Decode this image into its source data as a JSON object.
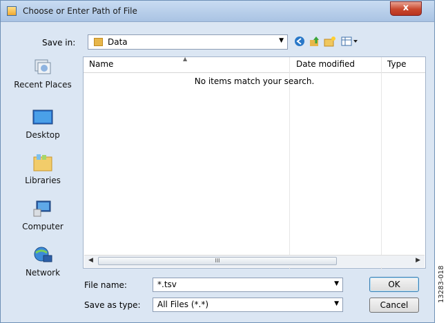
{
  "window": {
    "title": "Choose or Enter Path of File",
    "close_glyph": "x"
  },
  "toolbar": {
    "save_in_label": "Save in:",
    "current_folder": "Data",
    "icons": [
      "back-icon",
      "up-folder-icon",
      "new-folder-icon",
      "view-menu-icon"
    ]
  },
  "places": [
    {
      "label": "Recent Places",
      "icon": "recent-places-icon"
    },
    {
      "label": "Desktop",
      "icon": "desktop-icon"
    },
    {
      "label": "Libraries",
      "icon": "libraries-icon"
    },
    {
      "label": "Computer",
      "icon": "computer-icon"
    },
    {
      "label": "Network",
      "icon": "network-icon"
    }
  ],
  "filelist": {
    "columns": [
      "Name",
      "Date modified",
      "Type"
    ],
    "empty_message": "No items match your search.",
    "scroll_grip": "III"
  },
  "form": {
    "file_name_label": "File name:",
    "file_name_value": "*.tsv",
    "save_as_type_label": "Save as type:",
    "save_as_type_value": "All Files (*.*)"
  },
  "buttons": {
    "ok": "OK",
    "cancel": "Cancel"
  },
  "figure_code": "13283-018"
}
